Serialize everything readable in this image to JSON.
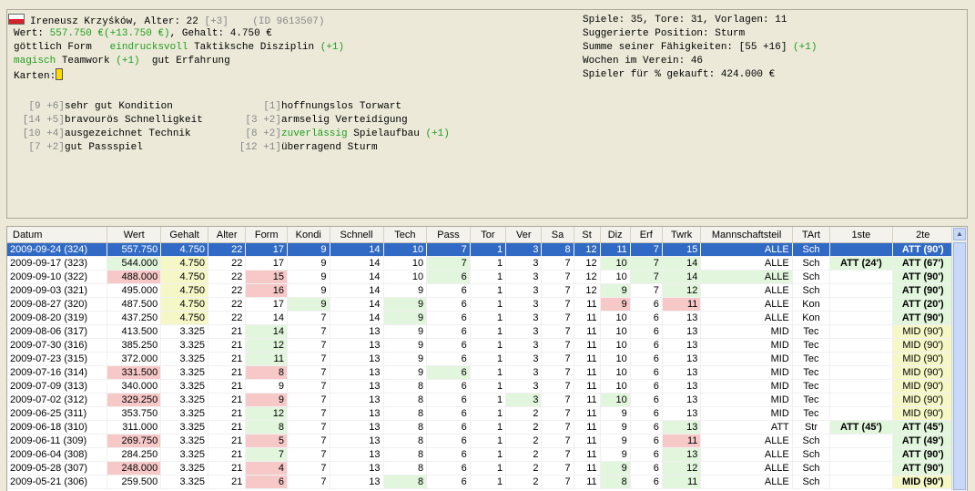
{
  "player": {
    "name": "Ireneusz Krzyśków,",
    "age_label": "Alter:",
    "age": "22",
    "age_extra": "[+3]",
    "id": "(ID 9613507)",
    "value_label": "Wert:",
    "value": "557.750 €",
    "value_change": "(+13.750 €)",
    "salary_label": ", Gehalt:",
    "salary": "4.750 €",
    "form_word": "göttlich",
    "form_label": "Form",
    "tactic_word": "eindrucksvoll",
    "tactic_label": "Taktiksche Disziplin",
    "tactic_bonus": "(+1)",
    "team_word": "magisch",
    "team_label": "Teamwork",
    "team_bonus": "(+1)",
    "exp_word": "gut",
    "exp_label": "Erfahrung",
    "cards_label": "Karten:"
  },
  "skills": {
    "left": [
      {
        "box": "[9 +6]",
        "text": "sehr gut Kondition",
        "bonus": ""
      },
      {
        "box": "[14 +5]",
        "text": "bravourös Schnelligkeit",
        "bonus": ""
      },
      {
        "box": "[10 +4]",
        "text": "ausgezeichnet Technik",
        "bonus": ""
      },
      {
        "box": "[7 +2]",
        "text": "gut Passspiel",
        "bonus": ""
      }
    ],
    "right": [
      {
        "box": "[1]",
        "word": "",
        "text": "hoffnungslos Torwart",
        "bonus": ""
      },
      {
        "box": "[3 +2]",
        "word": "",
        "text": "armselig Verteidigung",
        "bonus": ""
      },
      {
        "box": "[8 +2]",
        "word": "zuverlässig",
        "text": "Spielaufbau",
        "bonus": "(+1)"
      },
      {
        "box": "[12 +1]",
        "word": "",
        "text": "überragend Sturm",
        "bonus": ""
      }
    ]
  },
  "summary": {
    "line1": "Spiele: 35, Tore: 31, Vorlagen: 11",
    "line2": "Suggerierte Position: Sturm",
    "line3_label": "Summe seiner Fähigkeiten: [55 +16]",
    "line3_bonus": "(+1)",
    "line4": "Wochen im Verein: 46",
    "line5": "Spieler für % gekauft: 424.000 €"
  },
  "table": {
    "columns": [
      "Datum",
      "Wert",
      "Gehalt",
      "Alter",
      "Form",
      "Kondi",
      "Schnell",
      "Tech",
      "Pass",
      "Tor",
      "Ver",
      "Sa",
      "St",
      "Diz",
      "Erf",
      "Twrk",
      "Mannschaftsteil",
      "TArt",
      "1ste",
      "2te"
    ],
    "rows": [
      [
        "2009-09-24 (324)",
        "557.750",
        "4.750",
        "22",
        "17",
        "9",
        "14",
        "10",
        "7",
        "1",
        "3",
        "8",
        "12",
        "11",
        "7",
        "15",
        "ALLE",
        "Sch",
        "",
        "ATT (90')"
      ],
      [
        "2009-09-17 (323)",
        "544.000",
        "4.750",
        "22",
        "17",
        "9",
        "14",
        "10",
        "7",
        "1",
        "3",
        "7",
        "12",
        "10",
        "7",
        "14",
        "ALLE",
        "Sch",
        "ATT (24')",
        "ATT (67')"
      ],
      [
        "2009-09-10 (322)",
        "488.000",
        "4.750",
        "22",
        "15",
        "9",
        "14",
        "10",
        "6",
        "1",
        "3",
        "7",
        "12",
        "10",
        "7",
        "14",
        "ALLE",
        "Sch",
        "",
        "ATT (90')"
      ],
      [
        "2009-09-03 (321)",
        "495.000",
        "4.750",
        "22",
        "16",
        "9",
        "14",
        "9",
        "6",
        "1",
        "3",
        "7",
        "12",
        "9",
        "7",
        "12",
        "ALLE",
        "Sch",
        "",
        "ATT (90')"
      ],
      [
        "2009-08-27 (320)",
        "487.500",
        "4.750",
        "22",
        "17",
        "9",
        "14",
        "9",
        "6",
        "1",
        "3",
        "7",
        "11",
        "9",
        "6",
        "11",
        "ALLE",
        "Kon",
        "",
        "ATT (20')"
      ],
      [
        "2009-08-20 (319)",
        "437.250",
        "4.750",
        "22",
        "14",
        "7",
        "14",
        "9",
        "6",
        "1",
        "3",
        "7",
        "11",
        "10",
        "6",
        "13",
        "ALLE",
        "Kon",
        "",
        "ATT (90')"
      ],
      [
        "2009-08-06 (317)",
        "413.500",
        "3.325",
        "21",
        "14",
        "7",
        "13",
        "9",
        "6",
        "1",
        "3",
        "7",
        "11",
        "10",
        "6",
        "13",
        "MID",
        "Tec",
        "",
        "MID (90')"
      ],
      [
        "2009-07-30 (316)",
        "385.250",
        "3.325",
        "21",
        "12",
        "7",
        "13",
        "9",
        "6",
        "1",
        "3",
        "7",
        "11",
        "10",
        "6",
        "13",
        "MID",
        "Tec",
        "",
        "MID (90')"
      ],
      [
        "2009-07-23 (315)",
        "372.000",
        "3.325",
        "21",
        "11",
        "7",
        "13",
        "9",
        "6",
        "1",
        "3",
        "7",
        "11",
        "10",
        "6",
        "13",
        "MID",
        "Tec",
        "",
        "MID (90')"
      ],
      [
        "2009-07-16 (314)",
        "331.500",
        "3.325",
        "21",
        "8",
        "7",
        "13",
        "9",
        "6",
        "1",
        "3",
        "7",
        "11",
        "10",
        "6",
        "13",
        "MID",
        "Tec",
        "",
        "MID (90')"
      ],
      [
        "2009-07-09 (313)",
        "340.000",
        "3.325",
        "21",
        "9",
        "7",
        "13",
        "8",
        "6",
        "1",
        "3",
        "7",
        "11",
        "10",
        "6",
        "13",
        "MID",
        "Tec",
        "",
        "MID (90')"
      ],
      [
        "2009-07-02 (312)",
        "329.250",
        "3.325",
        "21",
        "9",
        "7",
        "13",
        "8",
        "6",
        "1",
        "3",
        "7",
        "11",
        "10",
        "6",
        "13",
        "MID",
        "Tec",
        "",
        "MID (90')"
      ],
      [
        "2009-06-25 (311)",
        "353.750",
        "3.325",
        "21",
        "12",
        "7",
        "13",
        "8",
        "6",
        "1",
        "2",
        "7",
        "11",
        "9",
        "6",
        "13",
        "MID",
        "Tec",
        "",
        "MID (90')"
      ],
      [
        "2009-06-18 (310)",
        "311.000",
        "3.325",
        "21",
        "8",
        "7",
        "13",
        "8",
        "6",
        "1",
        "2",
        "7",
        "11",
        "9",
        "6",
        "13",
        "ATT",
        "Str",
        "ATT (45')",
        "ATT (45')"
      ],
      [
        "2009-06-11 (309)",
        "269.750",
        "3.325",
        "21",
        "5",
        "7",
        "13",
        "8",
        "6",
        "1",
        "2",
        "7",
        "11",
        "9",
        "6",
        "11",
        "ALLE",
        "Sch",
        "",
        "ATT (49')"
      ],
      [
        "2009-06-04 (308)",
        "284.250",
        "3.325",
        "21",
        "7",
        "7",
        "13",
        "8",
        "6",
        "1",
        "2",
        "7",
        "11",
        "9",
        "6",
        "13",
        "ALLE",
        "Sch",
        "",
        "ATT (90')"
      ],
      [
        "2009-05-28 (307)",
        "248.000",
        "3.325",
        "21",
        "4",
        "7",
        "13",
        "8",
        "6",
        "1",
        "2",
        "7",
        "11",
        "9",
        "6",
        "12",
        "ALLE",
        "Sch",
        "",
        "ATT (90')"
      ],
      [
        "2009-05-21 (306)",
        "259.500",
        "3.325",
        "21",
        "6",
        "7",
        "13",
        "8",
        "6",
        "1",
        "2",
        "7",
        "11",
        "8",
        "6",
        "11",
        "ALLE",
        "Sch",
        "",
        "MID (90')"
      ]
    ],
    "highlights": [
      "G,G,Y,,,,,,,,,,,,,,,,,G",
      ",G,Y,,,,,,G,,,,,G,G,G,,,G,G",
      ",R,Y,,R,,,,G,,,,,,G,G,G,,,G",
      ",,Y,,R,,,,,,,,,G,,G,,,,G",
      ",,Y,,,G,,G,,,,,,R,,R,,,,G",
      ",,Y,,,,,G,,,,,,,,,,,,G",
      ",,,,G,,,,,,,,,,,,,,,Y",
      ",,,,G,,,,,,,,,,,,,,,Y",
      ",,,,G,,,,,,,,,,,,,,,Y",
      ",R,,,R,,,,G,,,,,,,,,,,Y",
      ",,,,,,,,,,,,,,,,,,,Y",
      ",R,,,R,,,,,,G,,,G,,,,,,Y",
      ",,,,G,,,,,,,,,,,,,,,Y",
      ",,,,G,,,,,,,,,,,G,,,G,G",
      ",R,,,R,,,,,,,,,,,R,,,,G",
      ",,,,G,,,,,,,,,,,G,,,,G",
      ",R,,,R,,,,,,,,,G,,G,,,,G",
      ",,,,R,,,G,,,,,,G,,G,,,,Y"
    ],
    "selected_row": 0
  }
}
